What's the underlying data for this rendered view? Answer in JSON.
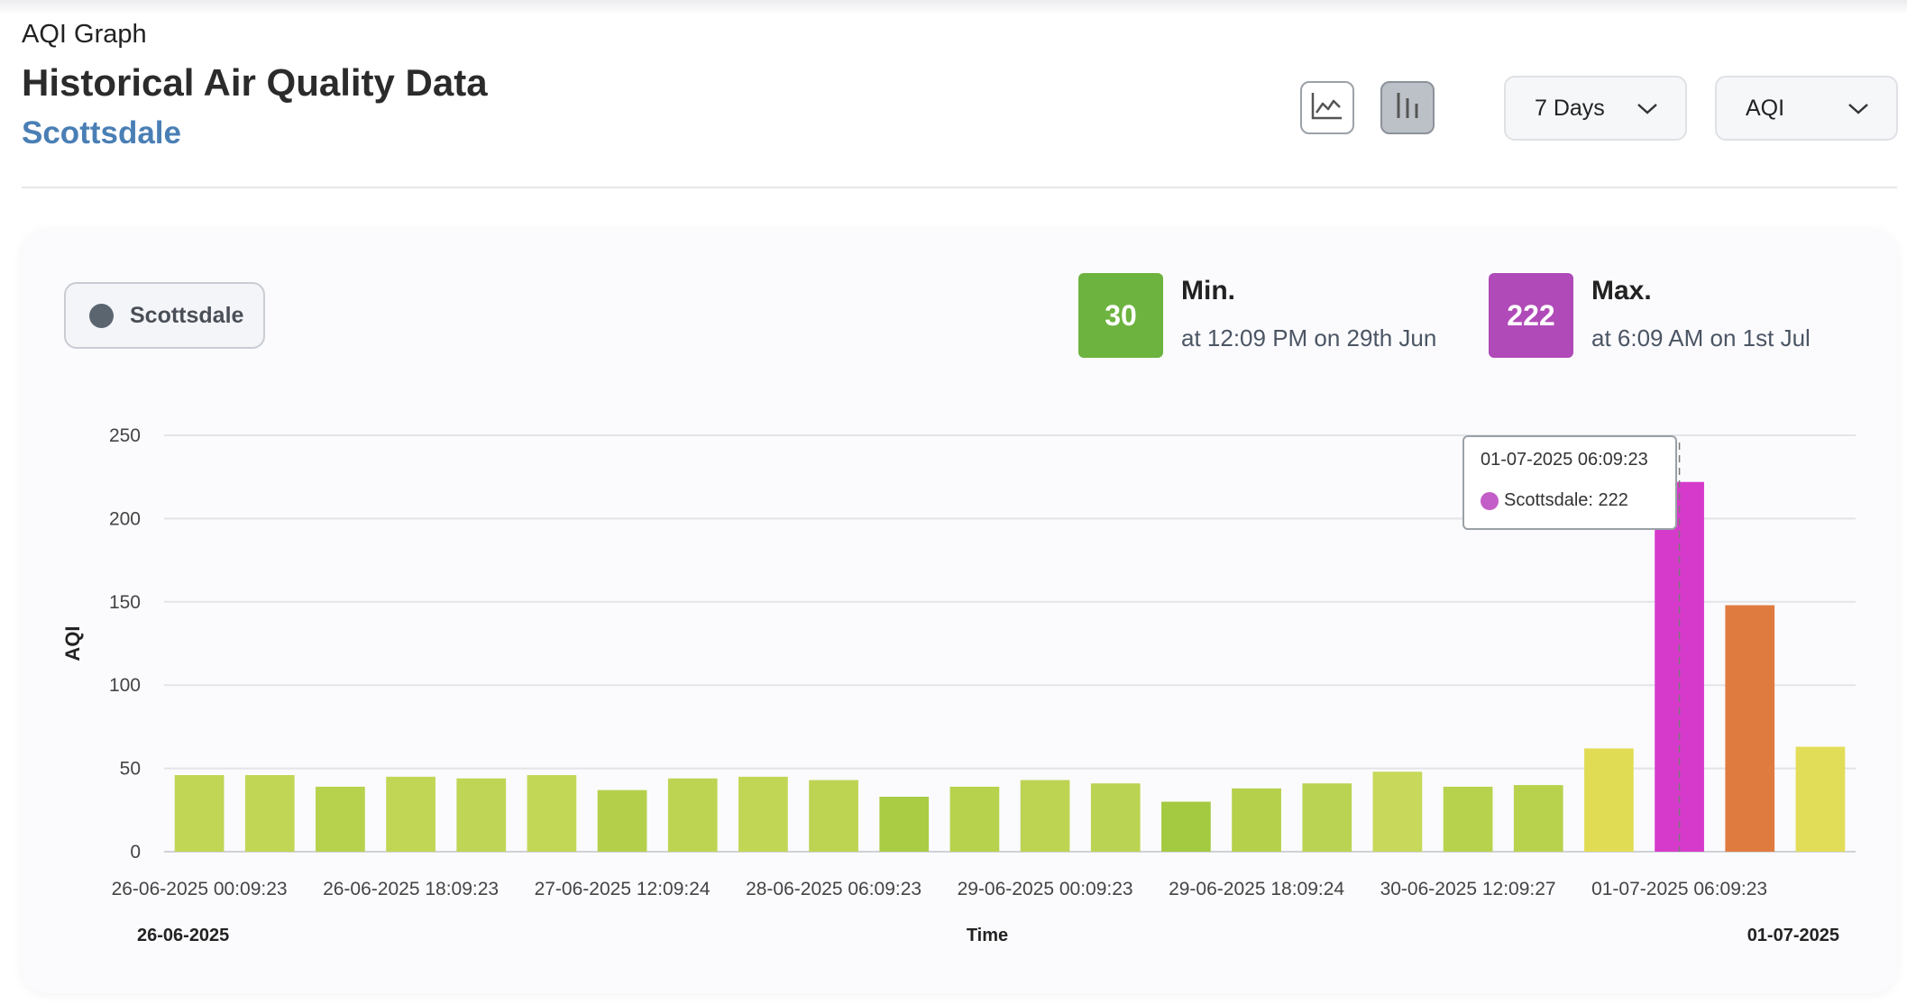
{
  "header": {
    "pretitle": "AQI Graph",
    "title": "Historical Air Quality Data",
    "location": "Scottsdale"
  },
  "toolbar": {
    "line_chart_icon": "line-chart-icon",
    "bar_chart_icon": "bar-chart-icon",
    "active_view": "bar",
    "range_dropdown": "7 Days",
    "metric_dropdown": "AQI"
  },
  "legend": {
    "series_name": "Scottsdale",
    "series_color": "#5b6570"
  },
  "stats": {
    "min": {
      "value": "30",
      "label": "Min.",
      "desc": "at 12:09 PM on 29th Jun",
      "color": "#6db33f"
    },
    "max": {
      "value": "222",
      "label": "Max.",
      "desc": "at 6:09 AM on 1st Jul",
      "color": "#b04ab8"
    }
  },
  "tooltip": {
    "timestamp": "01-07-2025 06:09:23",
    "text": "Scottsdale: 222"
  },
  "chart_data": {
    "type": "bar",
    "ylabel": "AQI",
    "xlabel": "Time",
    "ylim": [
      0,
      250
    ],
    "yticks": [
      0,
      50,
      100,
      150,
      200,
      250
    ],
    "grid": true,
    "x_tick_labels": [
      "26-06-2025 00:09:23",
      "26-06-2025 18:09:23",
      "27-06-2025 12:09:24",
      "28-06-2025 06:09:23",
      "29-06-2025 00:09:23",
      "29-06-2025 18:09:24",
      "30-06-2025 12:09:27",
      "01-07-2025 06:09:23"
    ],
    "x_range_start": "26-06-2025",
    "x_range_end": "01-07-2025",
    "series": [
      {
        "name": "Scottsdale",
        "values": [
          46,
          46,
          39,
          45,
          44,
          46,
          37,
          44,
          45,
          43,
          33,
          39,
          43,
          41,
          30,
          38,
          41,
          48,
          39,
          40,
          62,
          222,
          148,
          63
        ],
        "colors": [
          "#c1d655",
          "#c1d655",
          "#b7d24c",
          "#c1d655",
          "#bfd555",
          "#c3d757",
          "#b4d04b",
          "#bdd453",
          "#c1d655",
          "#bdd453",
          "#a9cc44",
          "#b7d24c",
          "#bdd453",
          "#bbd352",
          "#a4ca42",
          "#b5d14c",
          "#bbd352",
          "#c7d85a",
          "#b7d24c",
          "#b9d24e",
          "#e0dd55",
          "#d63acb",
          "#e07b40",
          "#e2dd58"
        ]
      }
    ]
  }
}
